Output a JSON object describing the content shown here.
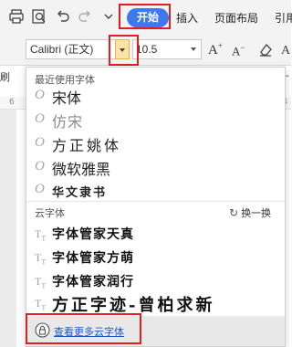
{
  "menu": {
    "home": "开始",
    "insert": "插入",
    "page_layout": "页面布局",
    "references": "引用"
  },
  "toolbar": {
    "font_name": "Calibri (正文)",
    "font_size": "10.5",
    "grow_font": "A",
    "grow_font_sup": "+",
    "shrink_font": "A",
    "shrink_font_sup": "−",
    "left_cut_label": "刷",
    "right_cut_label": "—"
  },
  "ruler": {
    "marks": [
      "6",
      "4"
    ]
  },
  "font_menu": {
    "recent_heading": "最近使用字体",
    "recent_fonts": [
      "宋体",
      "仿宋",
      "方正姚体",
      "微软雅黑",
      "华文隶书"
    ],
    "cloud_heading": "云字体",
    "refresh_label": "换一换",
    "cloud_fonts": [
      "字体管家天真",
      "字体管家方萌",
      "字体管家润行",
      "方正字迹-曾柏求新"
    ],
    "more_link": "查看更多云字体"
  },
  "colors": {
    "accent": "#3c78f0",
    "highlight_red": "#e02020",
    "link": "#1e58c8"
  }
}
